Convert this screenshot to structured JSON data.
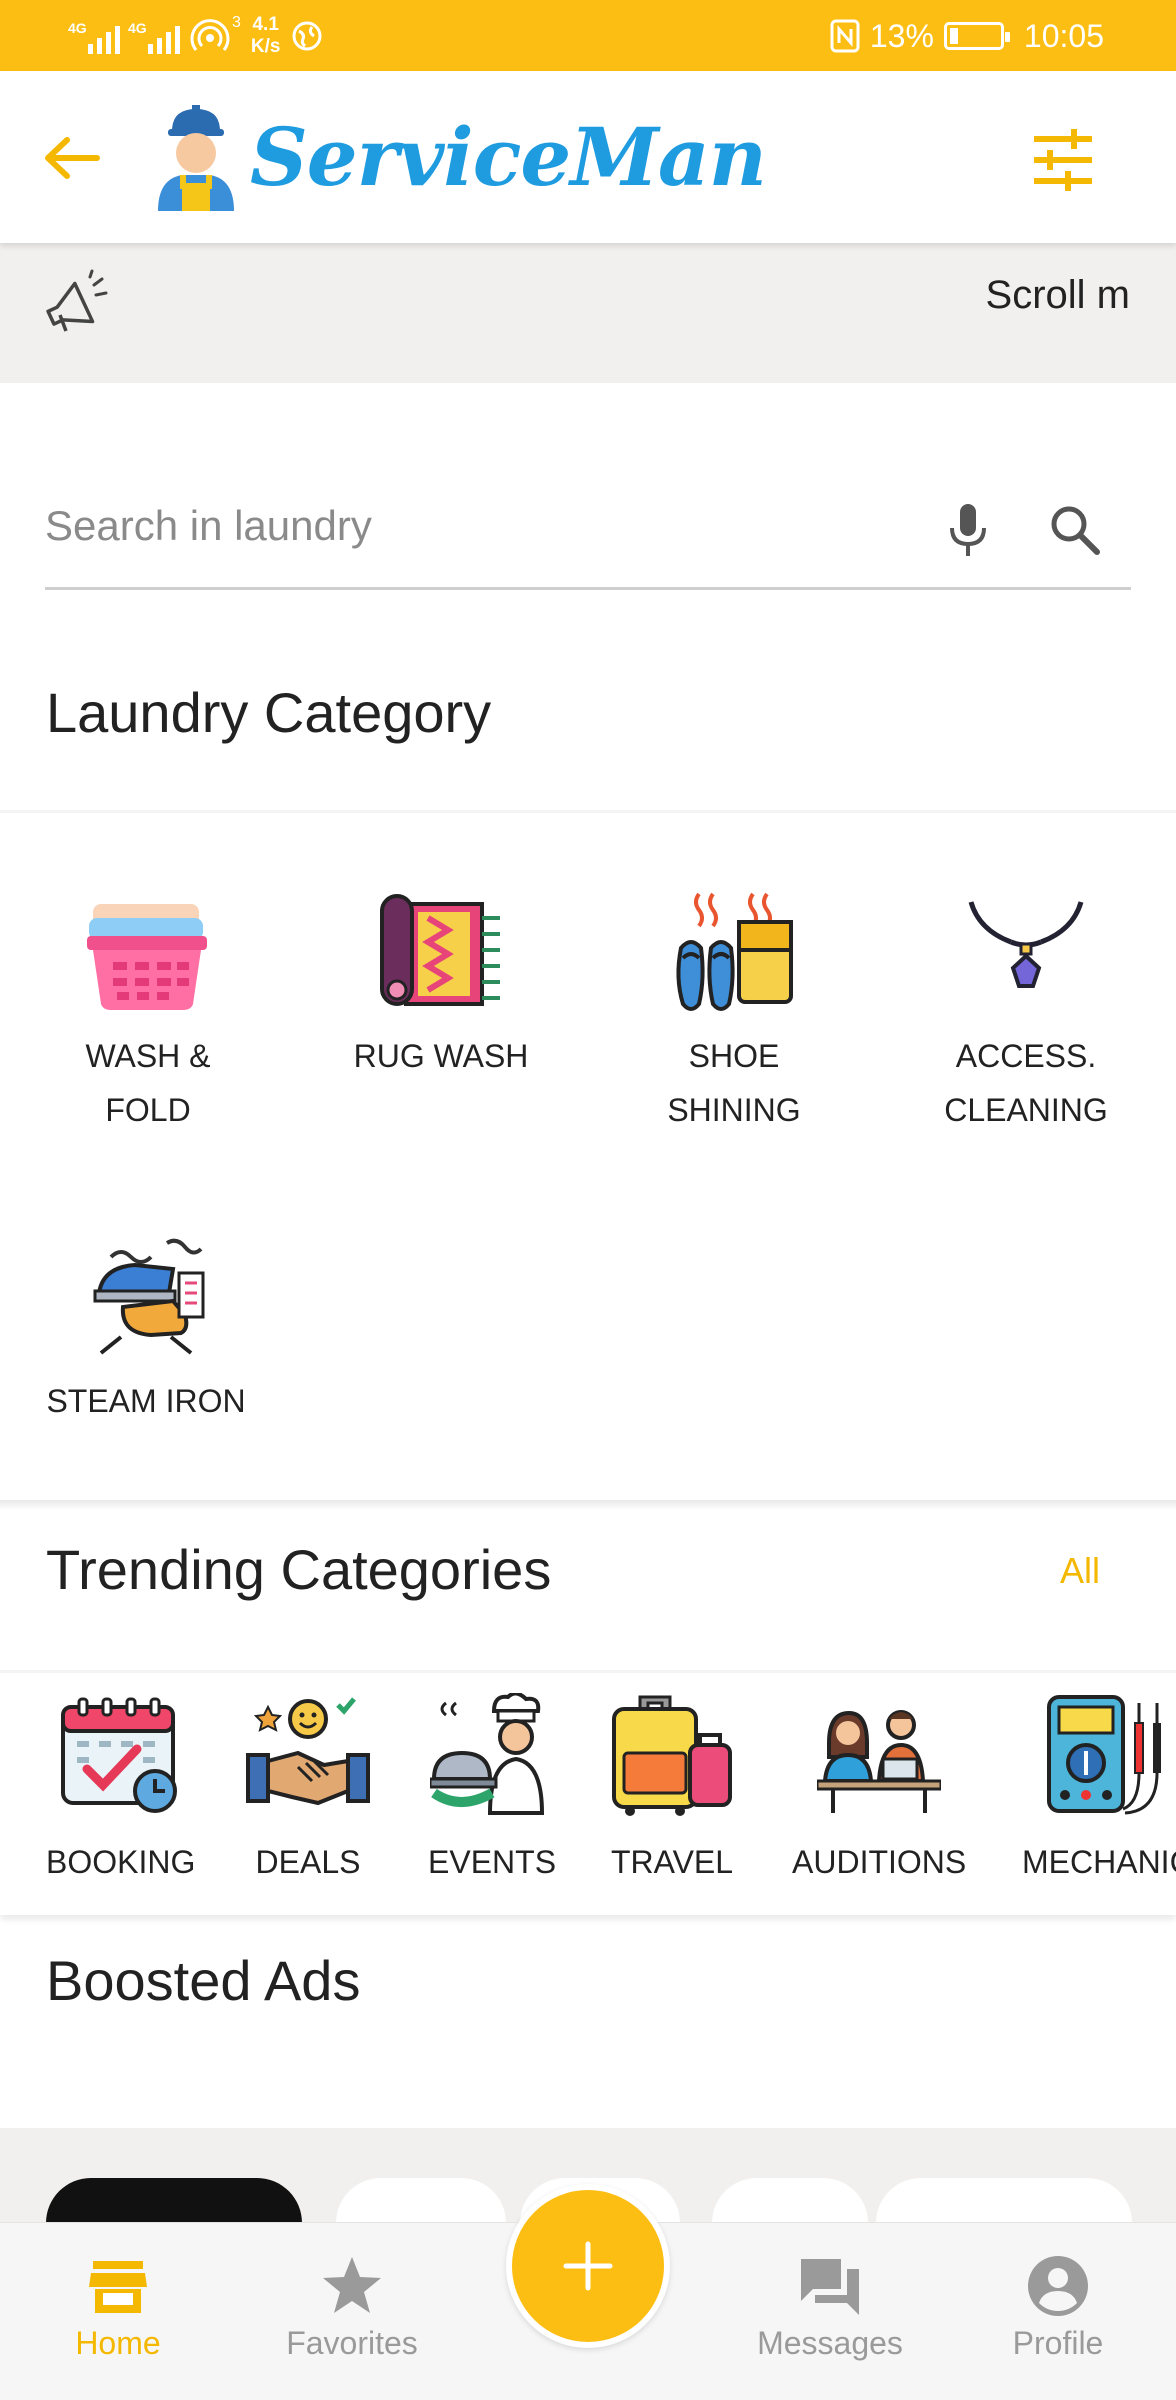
{
  "status_bar": {
    "signal_1": "4G",
    "signal_2": "4G",
    "hotspot_count": "3",
    "speed_value": "4.1",
    "speed_unit": "K/s",
    "battery_percent": "13%",
    "time": "10:05"
  },
  "app_bar": {
    "logo_text": "ServiceMan"
  },
  "marquee": {
    "text": "Scroll m"
  },
  "search": {
    "placeholder": "Search in laundry",
    "value": ""
  },
  "laundry": {
    "title": "Laundry Category",
    "items": [
      {
        "line1": "WASH &",
        "line2": "FOLD"
      },
      {
        "line1": "RUG WASH",
        "line2": ""
      },
      {
        "line1": "SHOE",
        "line2": "SHINING"
      },
      {
        "line1": "ACCESS.",
        "line2": "CLEANING"
      },
      {
        "line1": "STEAM IRON",
        "line2": ""
      }
    ]
  },
  "trending": {
    "title": "Trending Categories",
    "all_label": "All",
    "items": [
      {
        "label": "BOOKING"
      },
      {
        "label": "DEALS"
      },
      {
        "label": "EVENTS"
      },
      {
        "label": "TRAVEL"
      },
      {
        "label": "AUDITIONS"
      },
      {
        "label": "MECHANIC"
      }
    ]
  },
  "boosted": {
    "title": "Boosted Ads"
  },
  "bottom_nav": {
    "items": [
      {
        "label": "Home",
        "icon": "store-icon",
        "active": true
      },
      {
        "label": "Favorites",
        "icon": "star-icon",
        "active": false
      },
      {
        "label": "Messages",
        "icon": "chat-icon",
        "active": false
      },
      {
        "label": "Profile",
        "icon": "account-icon",
        "active": false
      }
    ],
    "fab_icon": "plus-icon"
  },
  "colors": {
    "accent": "#FDBE13",
    "brand_blue": "#1F9BE0",
    "active_label": "#F5B800",
    "inactive": "#9A9A9A"
  }
}
